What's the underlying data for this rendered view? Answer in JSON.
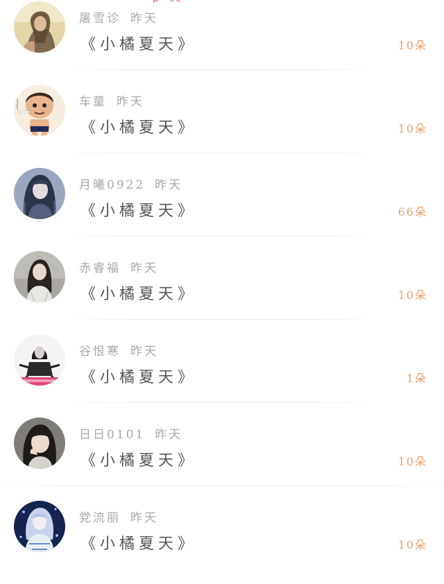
{
  "header_fragment": "p 风",
  "entries": [
    {
      "name": "屠雪诊",
      "time": "昨天",
      "title": "《小橘夏天》",
      "amount": "10朵",
      "avatar_icon": "portrait-woman-golden-icon",
      "avatar_colors": [
        "#d8c79a",
        "#6b5a44",
        "#e8d9b8"
      ]
    },
    {
      "name": "车童",
      "time": "昨天",
      "title": "《小橘夏天》",
      "amount": "10朵",
      "avatar_icon": "cartoon-boy-smoking-icon",
      "avatar_colors": [
        "#f3e7d3",
        "#3b2a22",
        "#e9b58c"
      ]
    },
    {
      "name": "月曦0922",
      "time": "昨天",
      "title": "《小橘夏天》",
      "amount": "66朵",
      "avatar_icon": "portrait-woman-blue-hair-icon",
      "avatar_colors": [
        "#7a8aa8",
        "#2c3448",
        "#c9ccd6"
      ]
    },
    {
      "name": "赤睿福",
      "time": "昨天",
      "title": "《小橘夏天》",
      "amount": "10朵",
      "avatar_icon": "portrait-woman-street-icon",
      "avatar_colors": [
        "#b5b5b0",
        "#2a2420",
        "#dedcd6"
      ]
    },
    {
      "name": "谷恨寒",
      "time": "昨天",
      "title": "《小橘夏天》",
      "amount": "1朵",
      "avatar_icon": "portrait-woman-sitting-bw-icon",
      "avatar_colors": [
        "#f2f2f2",
        "#1b1b1b",
        "#e0457a"
      ]
    },
    {
      "name": "日日0101",
      "time": "昨天",
      "title": "《小橘夏天》",
      "amount": "10朵",
      "avatar_icon": "portrait-girl-hand-chin-icon",
      "avatar_colors": [
        "#8c8a86",
        "#1e1a18",
        "#e8d6c8"
      ]
    },
    {
      "name": "党流丽",
      "time": "昨天",
      "title": "《小橘夏天》",
      "amount": "10朵",
      "avatar_icon": "anime-girl-blue-icon",
      "avatar_colors": [
        "#1a2c5a",
        "#9fb8e8",
        "#e8eef8"
      ]
    }
  ]
}
